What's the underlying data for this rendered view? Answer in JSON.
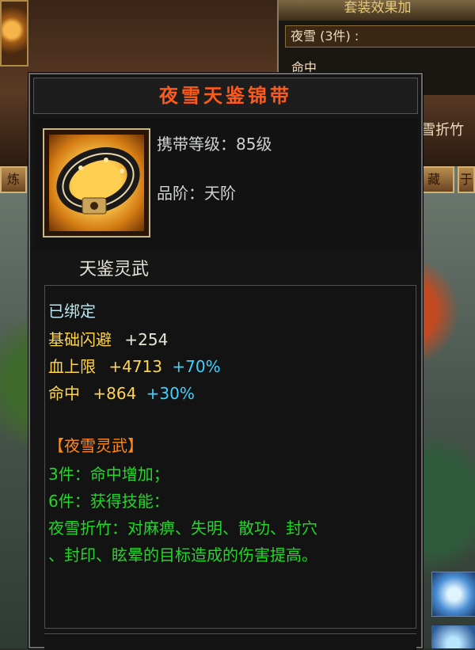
{
  "background": {
    "set_panel_title": "套装效果加",
    "set_row_label": "夜雪 (3件) :",
    "set_row2": "命中",
    "side_text": "雪折竹",
    "tab_left": "炼",
    "tab_right": "藏",
    "tab_far_right": "于"
  },
  "tooltip": {
    "title": "夜雪天鉴锦带",
    "carry_level": "携带等级：85级",
    "grade": "品阶：天阶",
    "sublabel": "天鉴灵武",
    "bound": "已绑定",
    "stats": [
      {
        "name": "基础闪避",
        "value": "+254",
        "bonus": ""
      },
      {
        "name": "血上限",
        "value": "+4713",
        "bonus": "+70%"
      },
      {
        "name": "命中",
        "value": "+864",
        "bonus": "+30%"
      }
    ],
    "set_name": "【夜雪灵武】",
    "set_effects": [
      "3件：命中增加；",
      "6件：获得技能：",
      "夜雪折竹：对麻痹、失明、散功、封穴",
      "、封印、眩晕的目标造成的伤害提高。"
    ]
  },
  "colors": {
    "title": "#ff5a1a",
    "stat_name": "#ffd54a",
    "percent_bonus": "#3bd3ff",
    "set_text": "#22d62a",
    "set_name": "#ff8a1a"
  }
}
